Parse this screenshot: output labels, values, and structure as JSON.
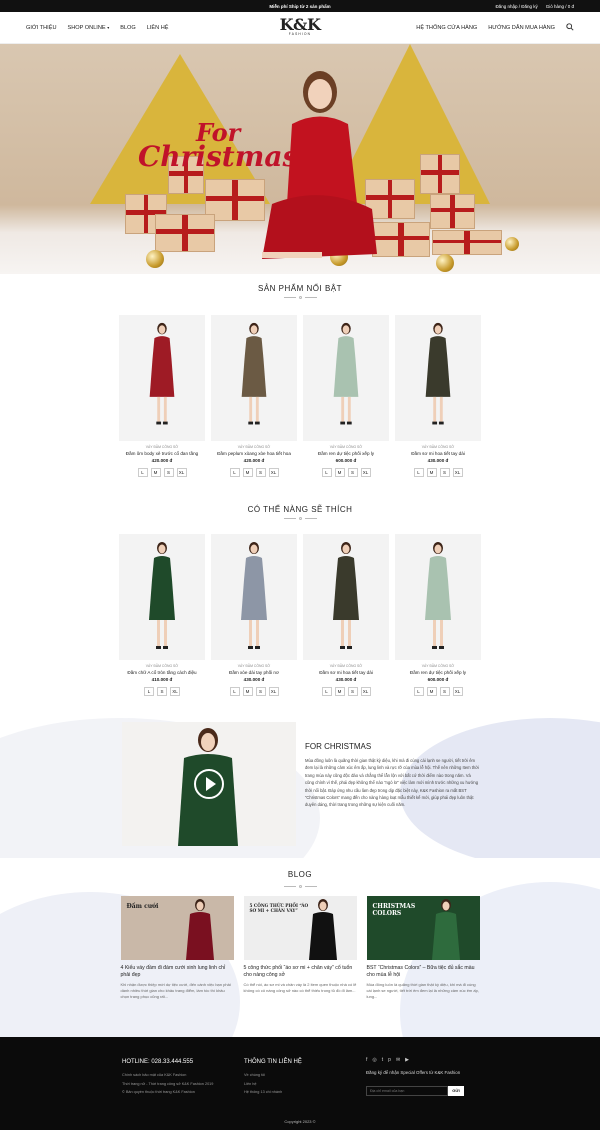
{
  "topbar": {
    "promo": "Miễn phí Ship từ 2 sản phẩm",
    "account": "Đăng nhập / Đăng ký",
    "cart": "Giỏ hàng / 0 đ"
  },
  "nav": {
    "left": [
      "GIỚI THIỆU",
      "SHOP ONLINE",
      "BLOG",
      "LIÊN HỆ"
    ],
    "right": [
      "HỆ THỐNG CỬA HÀNG",
      "HƯỚNG DẪN MUA HÀNG"
    ],
    "logo": "K&K",
    "logo_sub": "FASHION"
  },
  "hero": {
    "line1": "For",
    "line2": "Christmas"
  },
  "featured": {
    "title": "SẢN PHẨM NỔI BẬT",
    "products": [
      {
        "cat": "VÁY ĐẦM CÔNG SỞ",
        "name": "Đầm ôm body xẻ trước cổ đan tầng",
        "price": "420.000 đ",
        "sizes": [
          "L",
          "M",
          "S",
          "XL"
        ],
        "color": "#9e1b25"
      },
      {
        "cat": "VÁY ĐẦM CÔNG SỞ",
        "name": "Đầm peplum xòang xòe hoa tiết hoa",
        "price": "420.000 đ",
        "sizes": [
          "L",
          "M",
          "S",
          "XL"
        ],
        "color": "#6b5a44"
      },
      {
        "cat": "VÁY ĐẦM CÔNG SỞ",
        "name": "Đầm ren dự tiệc phối xếp ly",
        "price": "600.000 đ",
        "sizes": [
          "L",
          "M",
          "S",
          "XL"
        ],
        "color": "#a9c2b0"
      },
      {
        "cat": "VÁY ĐẦM CÔNG SỞ",
        "name": "Đầm sơ mi hoa tiết tay dài",
        "price": "430.000 đ",
        "sizes": [
          "L",
          "M",
          "S",
          "XL"
        ],
        "color": "#3a3a2c"
      }
    ]
  },
  "suggest": {
    "title": "CÓ THỂ NÀNG SẼ THÍCH",
    "products": [
      {
        "cat": "VÁY ĐẦM CÔNG SỞ",
        "name": "Đầm chữ A cổ tròn tầng cách điệu",
        "price": "410.000 đ",
        "sizes": [
          "L",
          "S",
          "XL"
        ],
        "color": "#1f4a2a"
      },
      {
        "cat": "VÁY ĐẦM CÔNG SỞ",
        "name": "Đầm xòe dài tay phối nơ",
        "price": "430.000 đ",
        "sizes": [
          "L",
          "M",
          "S",
          "XL"
        ],
        "color": "#8d96a6"
      },
      {
        "cat": "VÁY ĐẦM CÔNG SỞ",
        "name": "Đầm sơ mi hoa tiết tay dài",
        "price": "430.000 đ",
        "sizes": [
          "L",
          "M",
          "S",
          "XL"
        ],
        "color": "#3a3a2c"
      },
      {
        "cat": "VÁY ĐẦM CÔNG SỞ",
        "name": "Đầm ren dự tiệc phối xếp ly",
        "price": "600.000 đ",
        "sizes": [
          "L",
          "M",
          "S",
          "XL"
        ],
        "color": "#a9c2b0"
      }
    ]
  },
  "feature": {
    "title": "FOR CHRISTMAS",
    "body": "Mùa đông luôn là quãng thời gian thật kỳ diệu, khi mà đi cùng cái lạnh se người, tiết trời êm đem lại là những cảm xúc êm ấp, lung linh và rực rỡ của mùa lễ hội. Thế nên những Item thời trang mùa này cũng độc đáo và chẳng thể lẫn lộn với bất cứ thời điểm nào trong năm. Và cũng chính vì thế, phái đẹp không thể nào “ngó lơ” việc làm mới mình trước những xu hướng thời nổi bật. Đáp ứng nhu cầu làm đẹp trong dịp đặc biệt này, K&K Fashion ra mắt BST “Christmas Colors” mang đến cho nàng hàng loạt mẫu thiết kế mới, giúp phái đẹp luôn thật duyên dáng, thời trang trong những sự kiện cuối năm."
  },
  "blog": {
    "title": "BLOG",
    "posts": [
      {
        "title": "4 Kiểu váy đầm đi đám cưới xinh lung linh chỉ phải đẹp",
        "excerpt": "Khi nhận được thiệp mời dự tiệc cưới, đến cành việc bạn phải dành nhiều thời gian cho khâu trang điểm, làm tóc thì khâu chọn trang phục cũng rất...",
        "thumb_label": "Đầm cưới",
        "bg": "#c9b8a8"
      },
      {
        "title": "5 công thức phối “áo sơ mi + chân váy” cổ tuổn cho nàng công sở",
        "excerpt": "Có thể nói, áo sơ mi và chân váy là 2 item quen thuộc nhà có lẽ không có cô nàng công sở nào có thể thiếu trong tủ đồ đi làm...",
        "thumb_label": "5 CÔNG THỨC PHỐI “ÁO SƠ MI + CHÂN VÁY”",
        "bg": "#eeeeee"
      },
      {
        "title": "BST “Christmas Colors” – Bữa tiệc đủ sắc màu cho mùa lễ hội",
        "excerpt": "Mùa đông luôn là quãng thời gian thật kỳ diệu, khi mà đi cùng cái lạnh se người, tiết trời êm đem lại là những cảm xúc êm ấp, lung...",
        "thumb_label": "CHRISTMAS COLORS",
        "bg": "#1f4a2a"
      }
    ]
  },
  "footer": {
    "hotline": "HOTLINE: 028.33.444.555",
    "left_lines": [
      "Chính sách bảo mật của K&K Fashion",
      "Thời trang nữ - Thời trang công sở K&K Fashion 2019",
      "© Bản quyền thuộc thời trang K&K Fashion"
    ],
    "contact_title": "THÔNG TIN LIÊN HỆ",
    "contact_lines": [
      "Về chúng tôi",
      "Liên hệ",
      "Hệ thống 13 chi nhánh"
    ],
    "subscribe_text": "Đăng ký để nhận Special Offers từ K&K Fashion",
    "subscribe_placeholder": "Địa chỉ email của bạn",
    "subscribe_button": "GỬI",
    "copyright": "Copyright 2023 ©"
  }
}
